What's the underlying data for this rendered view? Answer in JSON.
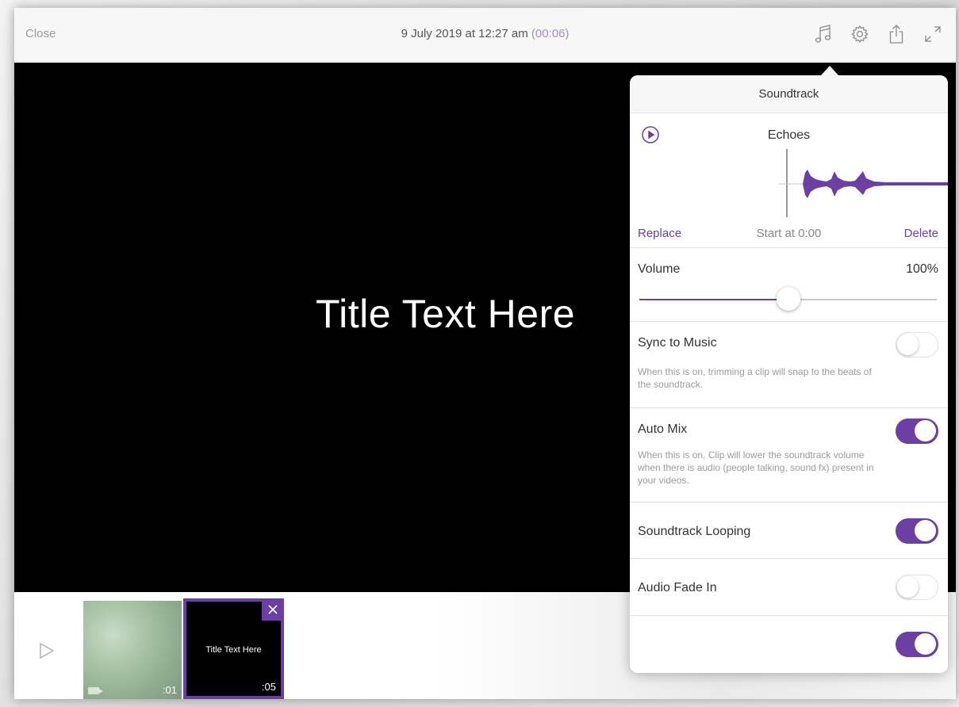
{
  "header": {
    "close_label": "Close",
    "title": "9 July 2019 at 12:27 am",
    "duration": "(00:06)",
    "icons": [
      "music-note-icon",
      "gear-icon",
      "share-icon",
      "expand-icon"
    ]
  },
  "preview": {
    "title_text": "Title Text Here"
  },
  "timeline": {
    "clips": [
      {
        "duration": ":01"
      },
      {
        "title": "Title Text Here",
        "duration": ":05"
      }
    ]
  },
  "soundtrack": {
    "header": "Soundtrack",
    "track_name": "Echoes",
    "replace_label": "Replace",
    "start_label": "Start at 0:00",
    "delete_label": "Delete",
    "volume_label": "Volume",
    "volume_value": "100%",
    "volume_level": 0.5,
    "sync_label": "Sync to Music",
    "sync_desc": "When this is on, trimming a clip will snap to the beats of the soundtrack.",
    "sync_on": false,
    "automix_label": "Auto Mix",
    "automix_desc": "When this is on, Clip will lower the soundtrack volume when there is audio (people talking, sound fx) present in your videos.",
    "automix_on": true,
    "looping_label": "Soundtrack Looping",
    "looping_on": true,
    "fadein_label": "Audio Fade In",
    "fadein_on": false,
    "fadeout_on": true
  },
  "colors": {
    "accent": "#6c3fa3",
    "muted_text": "#9b9b9b",
    "duration_text": "#a78bc9"
  }
}
